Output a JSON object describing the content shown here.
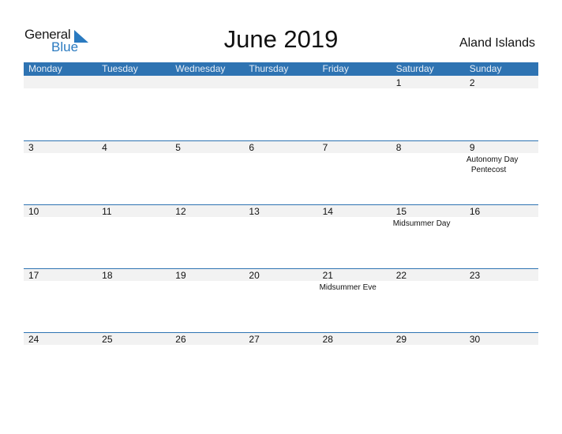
{
  "logo": {
    "word1": "General",
    "word2": "Blue"
  },
  "title": "June 2019",
  "region": "Aland Islands",
  "weekdays": [
    "Monday",
    "Tuesday",
    "Wednesday",
    "Thursday",
    "Friday",
    "Saturday",
    "Sunday"
  ],
  "weeks": [
    [
      {
        "day": ""
      },
      {
        "day": ""
      },
      {
        "day": ""
      },
      {
        "day": ""
      },
      {
        "day": ""
      },
      {
        "day": "1"
      },
      {
        "day": "2"
      }
    ],
    [
      {
        "day": "3"
      },
      {
        "day": "4"
      },
      {
        "day": "5"
      },
      {
        "day": "6"
      },
      {
        "day": "7"
      },
      {
        "day": "8"
      },
      {
        "day": "9",
        "events": [
          "Autonomy Day",
          "Pentecost"
        ]
      }
    ],
    [
      {
        "day": "10"
      },
      {
        "day": "11"
      },
      {
        "day": "12"
      },
      {
        "day": "13"
      },
      {
        "day": "14"
      },
      {
        "day": "15",
        "events": [
          "Midsummer Day"
        ]
      },
      {
        "day": "16"
      }
    ],
    [
      {
        "day": "17"
      },
      {
        "day": "18"
      },
      {
        "day": "19"
      },
      {
        "day": "20"
      },
      {
        "day": "21",
        "events": [
          "Midsummer Eve"
        ]
      },
      {
        "day": "22"
      },
      {
        "day": "23"
      }
    ],
    [
      {
        "day": "24"
      },
      {
        "day": "25"
      },
      {
        "day": "26"
      },
      {
        "day": "27"
      },
      {
        "day": "28"
      },
      {
        "day": "29"
      },
      {
        "day": "30"
      }
    ]
  ],
  "colors": {
    "accent": "#2e73b2",
    "date_strip": "#f2f2f2"
  }
}
